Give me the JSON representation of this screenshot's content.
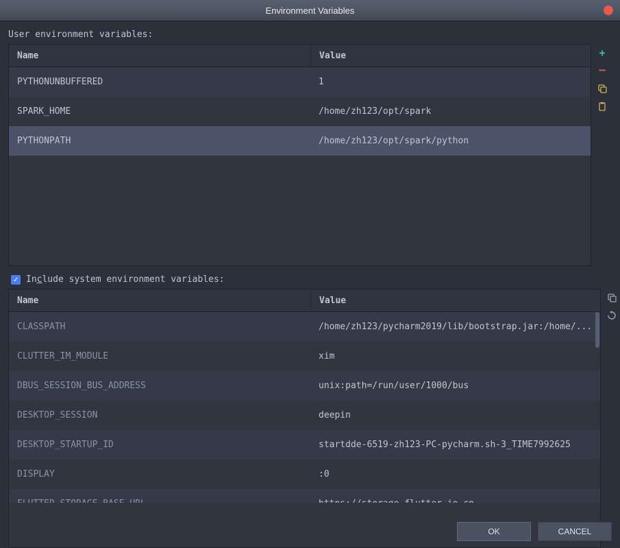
{
  "title": "Environment Variables",
  "labels": {
    "user_section": "User environment variables:",
    "include_prefix": "In",
    "include_hotkey": "c",
    "include_suffix": "lude system environment variables:"
  },
  "columns": {
    "name": "Name",
    "value": "Value"
  },
  "user_vars": [
    {
      "name": "PYTHONUNBUFFERED",
      "value": "1"
    },
    {
      "name": "SPARK_HOME",
      "value": "/home/zh123/opt/spark"
    },
    {
      "name": "PYTHONPATH",
      "value": "/home/zh123/opt/spark/python"
    }
  ],
  "user_selected_index": 2,
  "include_system_checked": true,
  "system_vars": [
    {
      "name": "CLASSPATH",
      "value": "/home/zh123/pycharm2019/lib/bootstrap.jar:/home/..."
    },
    {
      "name": "CLUTTER_IM_MODULE",
      "value": "xim"
    },
    {
      "name": "DBUS_SESSION_BUS_ADDRESS",
      "value": "unix:path=/run/user/1000/bus"
    },
    {
      "name": "DESKTOP_SESSION",
      "value": "deepin"
    },
    {
      "name": "DESKTOP_STARTUP_ID",
      "value": "startdde-6519-zh123-PC-pycharm.sh-3_TIME7992625"
    },
    {
      "name": "DISPLAY",
      "value": ":0"
    },
    {
      "name": "FLUTTER_STORAGE_BASE_URL",
      "value": "https://storage.flutter-io.cn"
    }
  ],
  "buttons": {
    "ok": "OK",
    "cancel": "CANCEL"
  }
}
